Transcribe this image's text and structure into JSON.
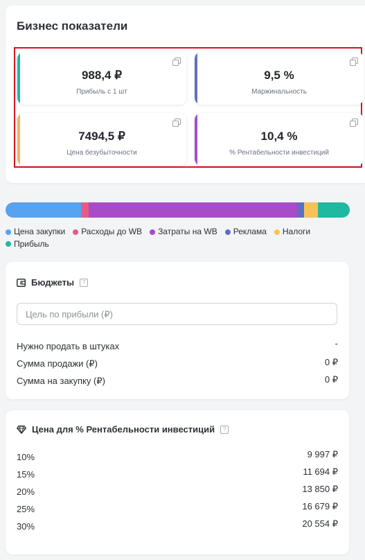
{
  "business": {
    "title": "Бизнес показатели",
    "metrics": [
      {
        "value": "988,4 ₽",
        "label": "Прибыль с 1 шт",
        "accent": "#20b8a6"
      },
      {
        "value": "9,5 %",
        "label": "Маржинальность",
        "accent": "#5f70c4"
      },
      {
        "value": "7494,5 ₽",
        "label": "Цена безубыточности",
        "accent": "#f2b35a"
      },
      {
        "value": "10,4 %",
        "label": "% Рентабельности инвестиций",
        "accent": "#a24fd0"
      }
    ]
  },
  "cost_structure": {
    "segments": [
      {
        "name": "Цена закупки",
        "color": "#57a3ef",
        "share": 0.22
      },
      {
        "name": "Расходы до WB",
        "color": "#e55b86",
        "share": 0.022
      },
      {
        "name": "Затраты на WB",
        "color": "#a74bc8",
        "share": 0.606
      },
      {
        "name": "Реклама",
        "color": "#5d6fc2",
        "share": 0.02
      },
      {
        "name": "Налоги",
        "color": "#f8c15a",
        "share": 0.04
      },
      {
        "name": "Прибыль",
        "color": "#1fb9a1",
        "share": 0.092
      }
    ]
  },
  "budgets": {
    "title": "Бюджеты",
    "goal_placeholder": "Цель по прибыли (₽)",
    "rows": [
      {
        "label": "Нужно продать в штуках",
        "value": "-"
      },
      {
        "label": "Сумма продажи (₽)",
        "value": "0 ₽"
      },
      {
        "label": "Сумма на закупку (₽)",
        "value": "0 ₽"
      }
    ]
  },
  "roi_prices": {
    "title": "Цена для % Рентабельности инвестиций",
    "rows": [
      {
        "percent": "10%",
        "price": "9 997 ₽"
      },
      {
        "percent": "15%",
        "price": "11 694 ₽"
      },
      {
        "percent": "20%",
        "price": "13 850 ₽"
      },
      {
        "percent": "25%",
        "price": "16 679 ₽"
      },
      {
        "percent": "30%",
        "price": "20 554 ₽"
      }
    ]
  }
}
